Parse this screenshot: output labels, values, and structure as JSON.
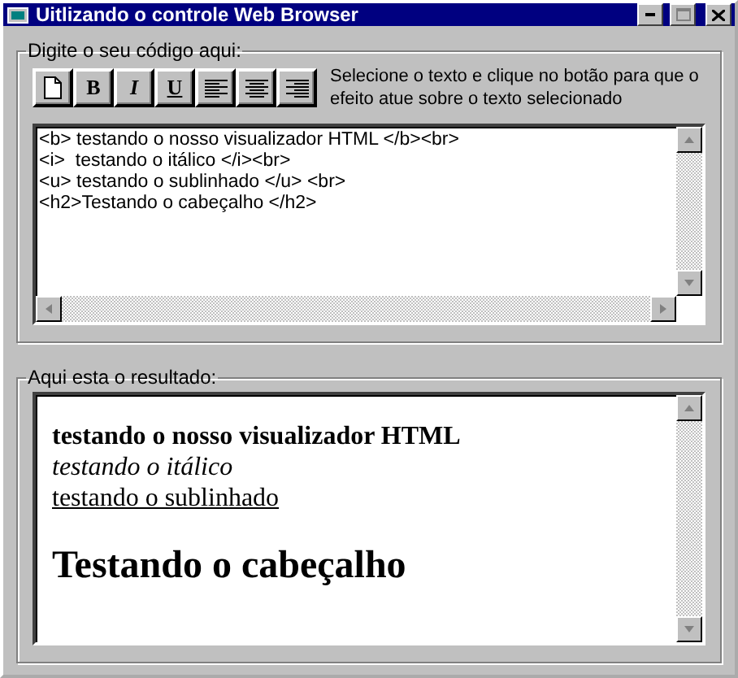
{
  "window": {
    "title": "Uitlizando o controle Web Browser"
  },
  "code_group": {
    "label": "Digite o seu código aqui:",
    "toolbar": [
      {
        "kind": "new"
      },
      {
        "kind": "bold",
        "label": "B"
      },
      {
        "kind": "italic",
        "label": "I"
      },
      {
        "kind": "underline",
        "label": "U"
      },
      {
        "kind": "align-left"
      },
      {
        "kind": "align-center"
      },
      {
        "kind": "align-right"
      }
    ],
    "hint": "Selecione o texto e clique no botão para que o efeito atue sobre o texto selecionado",
    "code_lines": [
      "<b> testando o nosso visualizador HTML </b><br>",
      "<i>  testando o itálico </i><br>",
      "<u> testando o sublinhado </u> <br>",
      "<h2>Testando o cabeçalho </h2>"
    ]
  },
  "result_group": {
    "label": "Aqui esta o resultado:",
    "lines": [
      {
        "kind": "bold",
        "text": "testando o nosso visualizador HTML"
      },
      {
        "kind": "italic",
        "text": "testando o itálico"
      },
      {
        "kind": "underline",
        "text": "testando o sublinhado"
      },
      {
        "kind": "heading",
        "text": "Testando o cabeçalho"
      }
    ]
  }
}
